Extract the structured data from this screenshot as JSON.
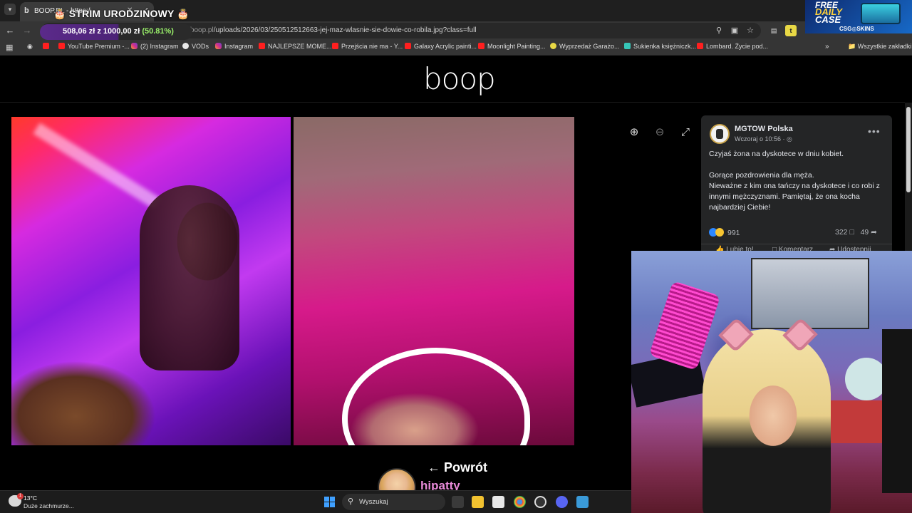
{
  "browser": {
    "tab_title": "BOOP.PL - https://img.boop.pl/...",
    "url_dim": "https://img.boop.pl",
    "url_path": "/uploads/2026/03/250512512663-jej-maz-wlasnie-sie-dowie-co-robila.jpg?class=full",
    "bookmarks": [
      {
        "label": "YouTube Premium -...",
        "icon": "youtube-icon"
      },
      {
        "label": "(2) Instagram",
        "icon": "instagram-icon"
      },
      {
        "label": "VODs",
        "icon": "vod-icon"
      },
      {
        "label": "Instagram",
        "icon": "instagram-icon"
      },
      {
        "label": "NAJLEPSZE MOME...",
        "icon": "youtube-icon"
      },
      {
        "label": "Przejścia nie ma - Y...",
        "icon": "youtube-icon"
      },
      {
        "label": "Galaxy Acrylic painti...",
        "icon": "youtube-icon"
      },
      {
        "label": "Moonlight Painting...",
        "icon": "youtube-icon"
      },
      {
        "label": "Wyprzedaż Garażo...",
        "icon": "gd-icon"
      },
      {
        "label": "Sukienka księżniczk...",
        "icon": "sk-icon"
      },
      {
        "label": "Lombard. Życie pod...",
        "icon": "youtube-icon"
      }
    ],
    "all_bookmarks": "Wszystkie zakładki"
  },
  "stream_overlay": {
    "title": "STRIM URODZIŃOWY",
    "goal_amount": "508,06 zł z 1000,00 zł",
    "goal_percent": "(50.81%)",
    "goal_fraction": 0.5081,
    "streamer_name": "hipatty"
  },
  "promo": {
    "line1": "FREE",
    "line2": "DAILY",
    "line3": "CASE",
    "brand": "CSG◎SKINS"
  },
  "page": {
    "logo": "boop",
    "back_link": "← Powrót"
  },
  "facebook_post": {
    "author": "MGTOW Polska",
    "time": "Wczoraj o 10:56 · ◎",
    "text": "Czyjaś żona na dyskotece w dniu kobiet.\n\nGorące pozdrowienia dla męża.\nNieważne z kim ona tańczy na dyskotece i co robi z innymi mężczyznami. Pamiętaj, że ona kocha najbardziej Ciebie!",
    "reactions": "991",
    "comments": "322",
    "shares": "49",
    "actions": [
      "Lubię to!",
      "Komentarz",
      "Udostępnij"
    ]
  },
  "taskbar": {
    "temperature": "13°C",
    "weather": "Duże zachmurze...",
    "search_placeholder": "Wyszukaj"
  }
}
